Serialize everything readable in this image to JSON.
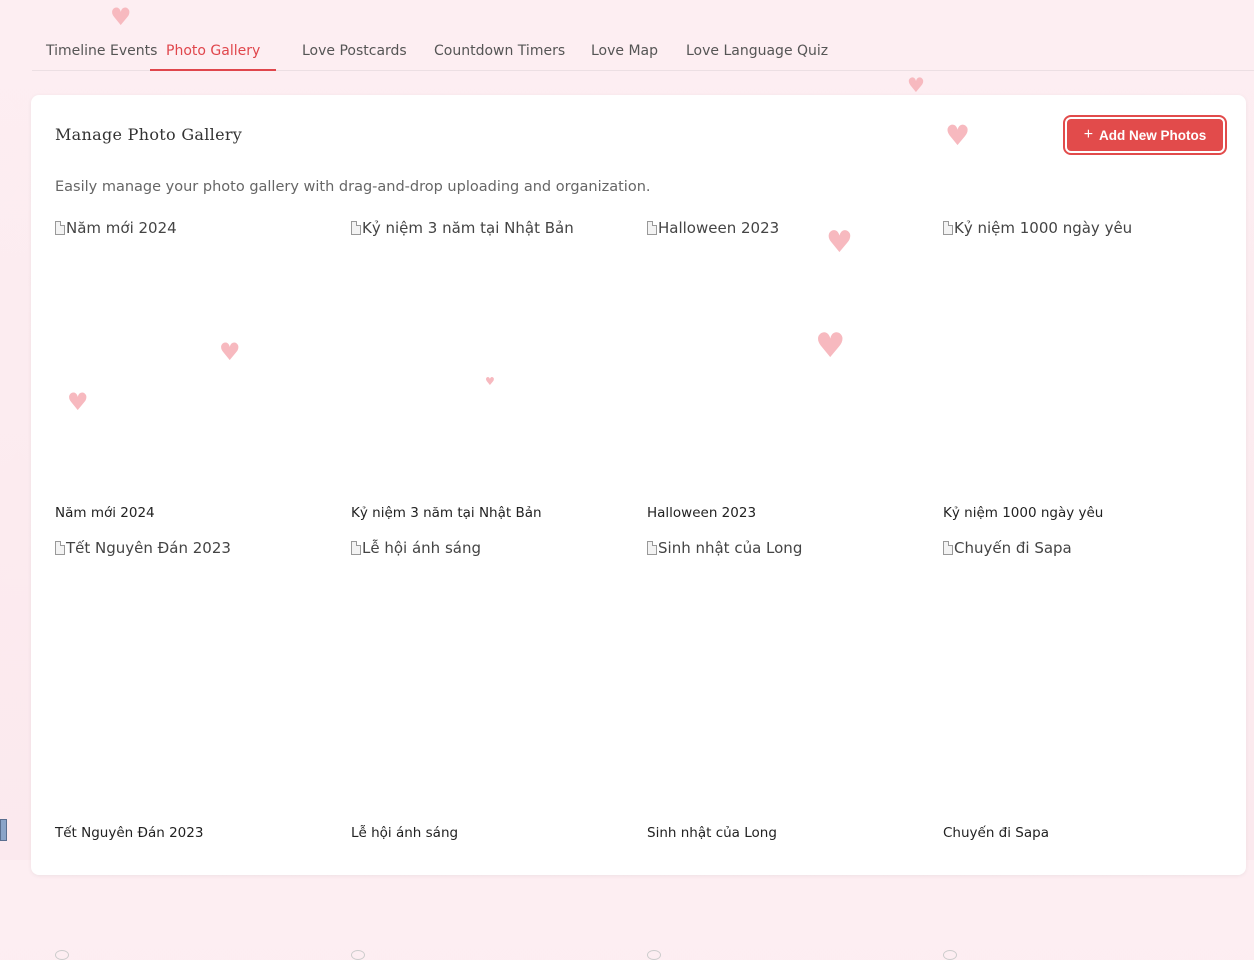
{
  "tabs": [
    {
      "label": "Timeline Events",
      "active": false
    },
    {
      "label": "Photo Gallery",
      "active": true
    },
    {
      "label": "Love Postcards",
      "active": false
    },
    {
      "label": "Countdown Timers",
      "active": false
    },
    {
      "label": "Love Map",
      "active": false
    },
    {
      "label": "Love Language Quiz",
      "active": false
    }
  ],
  "gallery": {
    "title": "Manage Photo Gallery",
    "subtitle": "Easily manage your photo gallery with drag-and-drop uploading and organization.",
    "add_button_label": "Add New Photos",
    "add_button_icon": "plus-icon",
    "items": [
      {
        "alt": "Năm mới 2024",
        "caption": "Năm mới 2024"
      },
      {
        "alt": "Kỷ niệm 3 năm tại Nhật Bản",
        "caption": "Kỷ niệm 3 năm tại Nhật Bản"
      },
      {
        "alt": "Halloween 2023",
        "caption": "Halloween 2023"
      },
      {
        "alt": "Kỷ niệm 1000 ngày yêu",
        "caption": "Kỷ niệm 1000 ngày yêu"
      },
      {
        "alt": "Tết Nguyên Đán 2023",
        "caption": "Tết Nguyên Đán 2023"
      },
      {
        "alt": "Lễ hội ánh sáng",
        "caption": "Lễ hội ánh sáng"
      },
      {
        "alt": "Sinh nhật của Long",
        "caption": "Sinh nhật của Long"
      },
      {
        "alt": "Chuyến đi Sapa",
        "caption": "Chuyến đi Sapa"
      }
    ]
  },
  "colors": {
    "accent": "#e24b4b",
    "heart": "#f7b9bf",
    "background": "#fdeef2"
  }
}
